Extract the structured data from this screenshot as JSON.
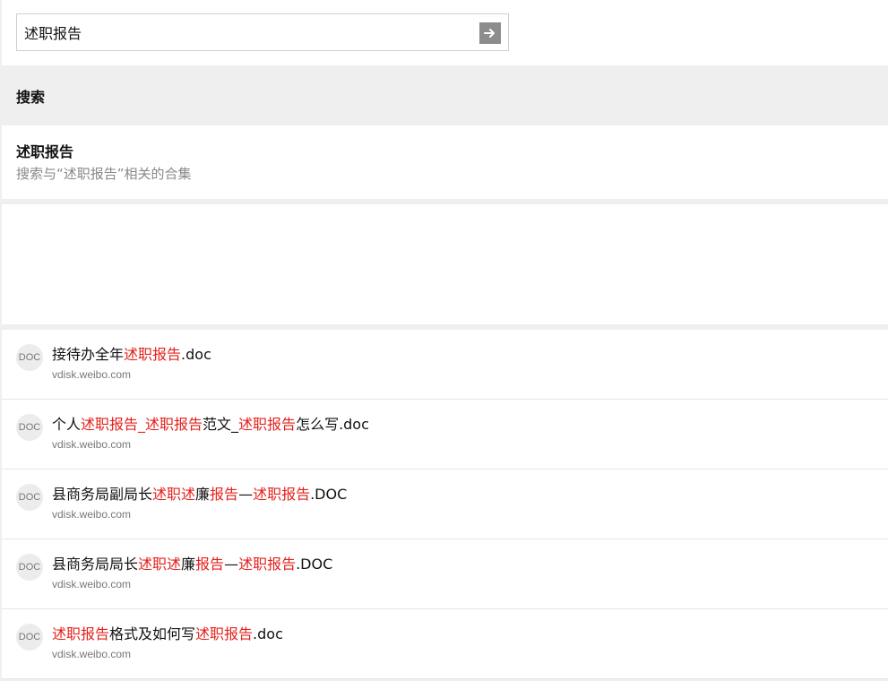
{
  "search": {
    "value": "述职报告"
  },
  "section": {
    "label": "搜索"
  },
  "suggestion": {
    "title": "述职报告",
    "subtitle": "搜索与“述职报告”相关的合集"
  },
  "icons": {
    "search_go": "arrow-right-icon",
    "doc": "doc-icon"
  },
  "results": [
    {
      "badge": "DOC",
      "domain": "vdisk.weibo.com",
      "segments": [
        {
          "t": "接待办全年",
          "h": false
        },
        {
          "t": "述职报告",
          "h": true
        },
        {
          "t": ".doc",
          "h": false
        }
      ]
    },
    {
      "badge": "DOC",
      "domain": "vdisk.weibo.com",
      "segments": [
        {
          "t": "个人",
          "h": false
        },
        {
          "t": "述职报告_述职报告",
          "h": true
        },
        {
          "t": "范文_",
          "h": false
        },
        {
          "t": "述职报告",
          "h": true
        },
        {
          "t": "怎么写.doc",
          "h": false
        }
      ]
    },
    {
      "badge": "DOC",
      "domain": "vdisk.weibo.com",
      "segments": [
        {
          "t": "县商务局副局长",
          "h": false
        },
        {
          "t": "述职述",
          "h": true
        },
        {
          "t": "廉",
          "h": false
        },
        {
          "t": "报告",
          "h": true
        },
        {
          "t": "—",
          "h": false
        },
        {
          "t": "述职报告",
          "h": true
        },
        {
          "t": ".DOC",
          "h": false
        }
      ]
    },
    {
      "badge": "DOC",
      "domain": "vdisk.weibo.com",
      "segments": [
        {
          "t": "县商务局局长",
          "h": false
        },
        {
          "t": "述职述",
          "h": true
        },
        {
          "t": "廉",
          "h": false
        },
        {
          "t": "报告",
          "h": true
        },
        {
          "t": "—",
          "h": false
        },
        {
          "t": "述职报告",
          "h": true
        },
        {
          "t": ".DOC",
          "h": false
        }
      ]
    },
    {
      "badge": "DOC",
      "domain": "vdisk.weibo.com",
      "segments": [
        {
          "t": "述职报告",
          "h": true
        },
        {
          "t": "格式及如何写",
          "h": false
        },
        {
          "t": "述职报告",
          "h": true
        },
        {
          "t": ".doc",
          "h": false
        }
      ]
    }
  ],
  "colors": {
    "highlight": "#e3211c",
    "band": "#efefef",
    "go_button": "#8c8c8c"
  }
}
